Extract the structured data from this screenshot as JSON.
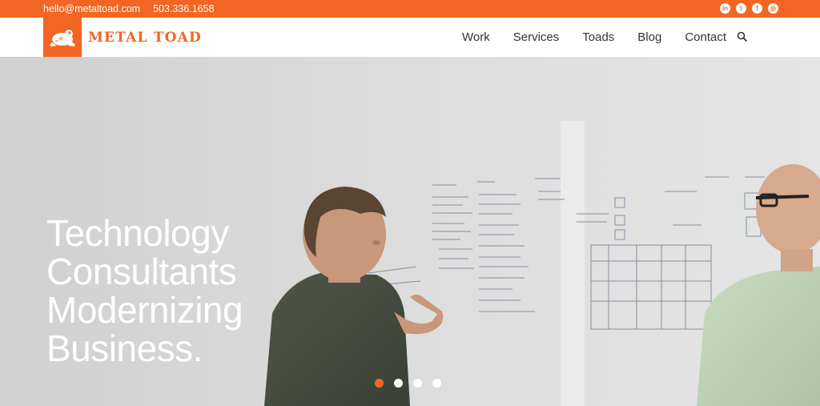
{
  "topbar": {
    "email": "hello@metaltoad.com",
    "phone": "503.336.1658",
    "social": [
      {
        "icon": "linkedin-icon",
        "glyph": "in"
      },
      {
        "icon": "twitter-icon",
        "glyph": "t"
      },
      {
        "icon": "facebook-icon",
        "glyph": "f"
      },
      {
        "icon": "instagram-icon",
        "glyph": "◎"
      }
    ]
  },
  "header": {
    "brand": "METAL TOAD",
    "nav": [
      "Work",
      "Services",
      "Toads",
      "Blog",
      "Contact"
    ]
  },
  "hero": {
    "headline": [
      "Technology",
      "Consultants",
      "Modernizing",
      "Business."
    ],
    "slides": 4,
    "active_slide": 1
  },
  "colors": {
    "accent": "#f26522",
    "nav_text": "#333333",
    "hero_text": "#ffffff"
  }
}
